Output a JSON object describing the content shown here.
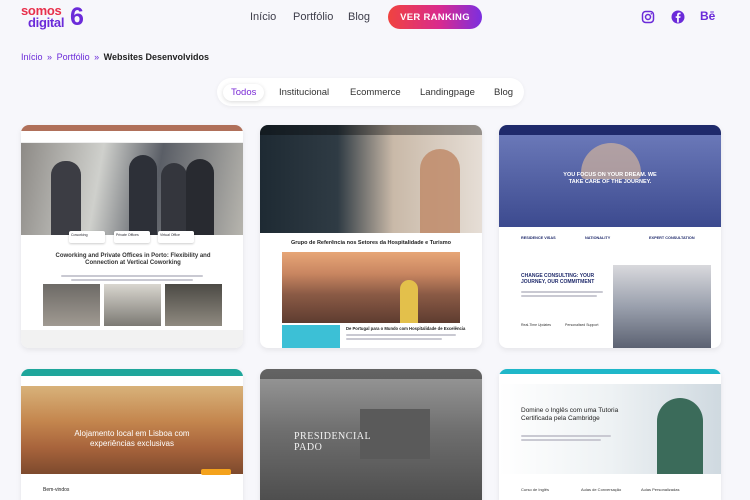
{
  "header": {
    "logo": {
      "line1": "somos",
      "line2": "digital",
      "mark": "6"
    },
    "nav": [
      {
        "label": "Início"
      },
      {
        "label": "Portfólio"
      },
      {
        "label": "Blog"
      }
    ],
    "cta_label": "VER RANKING",
    "social": [
      {
        "icon": "instagram-icon"
      },
      {
        "icon": "facebook-icon"
      },
      {
        "icon": "behance-icon"
      }
    ],
    "behance_text": "Bē"
  },
  "breadcrumb": {
    "home": "Início",
    "sep": "»",
    "section": "Portfólio",
    "current": "Websites Desenvolvidos"
  },
  "filters": [
    {
      "label": "Todos",
      "active": true
    },
    {
      "label": "Institucional",
      "active": false
    },
    {
      "label": "Ecommerce",
      "active": false
    },
    {
      "label": "Landingpage",
      "active": false
    },
    {
      "label": "Blog",
      "active": false
    }
  ],
  "cards": [
    {
      "heading": "Coworking and Private Offices in Porto: Flexibility and Connection at Vertical Coworking",
      "thumbs": [
        "Coworking",
        "Private Offices",
        "Virtual Office"
      ]
    },
    {
      "heading": "Grupo de Referência nos Setores da Hospitalidade e Turismo",
      "sub": "De Portugal para o Mundo com Hospitalidade de Excelência"
    },
    {
      "hero": "YOU FOCUS ON YOUR DREAM. WE TAKE CARE OF THE JOURNEY.",
      "services": [
        "RESIDENCE VISAS",
        "NATIONALITY",
        "EXPERT CONSULTATION"
      ],
      "heading": "CHANGE CONSULTING: YOUR JOURNEY, OUR COMMITMENT",
      "features": [
        "Real-Time Updates",
        "Personalised Support"
      ]
    },
    {
      "heading": "Alojamento local em Lisboa com experiências exclusivas",
      "welcome": "Bem-vindos"
    },
    {
      "heading": "PRESIDENCIAL PADO"
    },
    {
      "heading": "Domine o Inglês com uma Tutoria Certificada pela Cambridge",
      "courses": [
        "Curso de Inglês",
        "Aulas de Conversação",
        "Aulas Personalizadas"
      ]
    }
  ],
  "colors": {
    "accent": "#6b2bd9",
    "brand_red": "#e8304b",
    "cta_start": "#f0433f",
    "cta_end": "#7b2fe0"
  }
}
